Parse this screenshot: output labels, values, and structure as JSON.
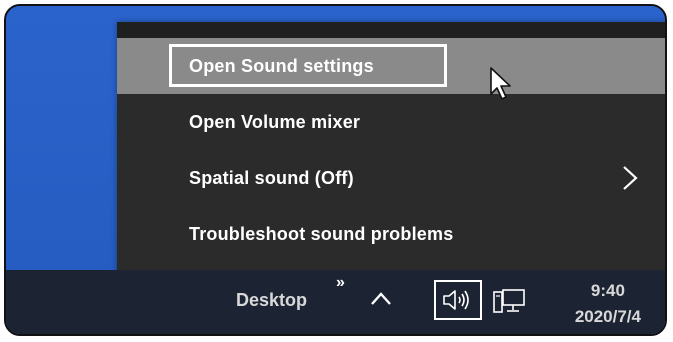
{
  "menu": {
    "items": [
      {
        "label": "Open Sound settings",
        "state": "hovered-focused"
      },
      {
        "label": "Open Volume mixer"
      },
      {
        "label": "Spatial sound (Off)",
        "has_submenu": true
      },
      {
        "label": "Troubleshoot sound problems"
      }
    ]
  },
  "taskbar": {
    "desktop_label": "Desktop",
    "overflow_label": "»",
    "time": "9:40",
    "date": "2020/7/4"
  },
  "colors": {
    "desktop_blue": "#2a62c9",
    "menu_bg": "#2b2b2b",
    "menu_hover": "#8a8a8a",
    "taskbar_bg": "#1c2433"
  },
  "icons": [
    "chevron-right-icon",
    "mouse-pointer-icon",
    "chevron-up-icon",
    "speaker-icon",
    "network-icon"
  ]
}
